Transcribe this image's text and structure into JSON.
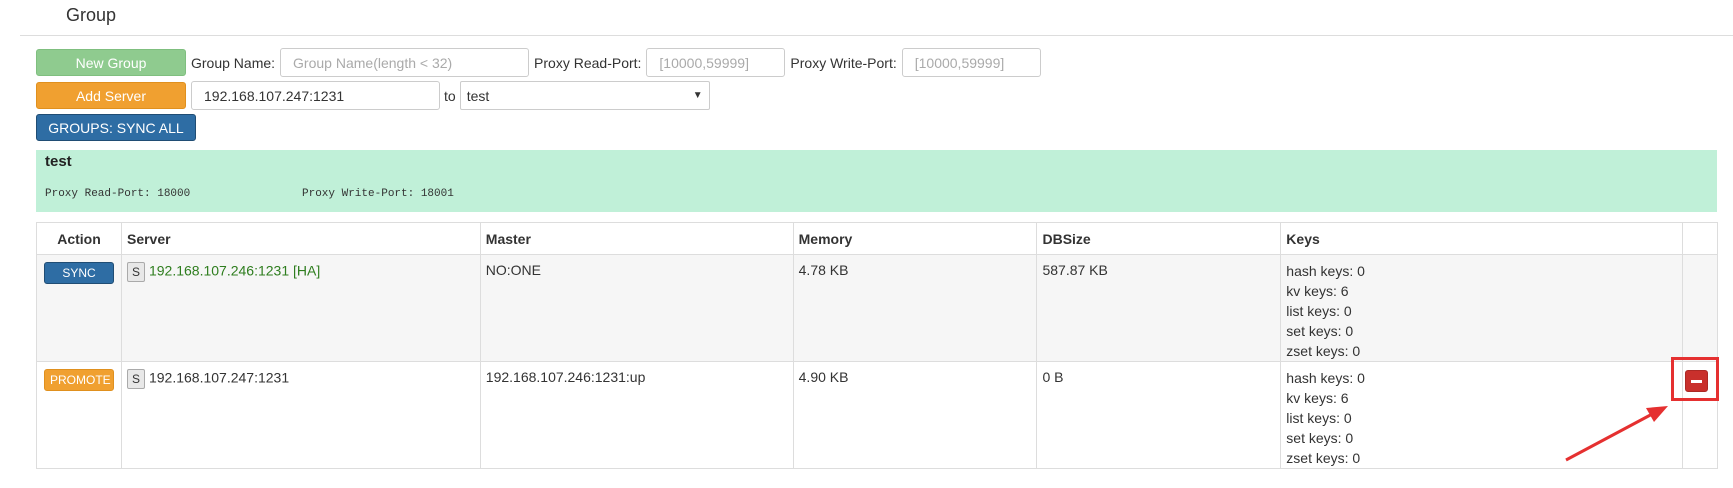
{
  "header": {
    "title": "Group"
  },
  "toolbar": {
    "new_group_label": "New Group",
    "group_name_label": "Group Name:",
    "group_name_placeholder": "Group Name(length < 32)",
    "proxy_read_label": "Proxy Read-Port:",
    "proxy_read_placeholder": "[10000,59999]",
    "proxy_write_label": "Proxy Write-Port:",
    "proxy_write_placeholder": "[10000,59999]",
    "add_server_label": "Add Server",
    "server_value": "192.168.107.247:1231",
    "to_label": "to",
    "target_group": "test",
    "sync_all_label": "GROUPS: SYNC ALL"
  },
  "group": {
    "name": "test",
    "proxy_read": "Proxy Read-Port: 18000",
    "proxy_write": "Proxy Write-Port: 18001"
  },
  "table": {
    "headers": [
      "Action",
      "Server",
      "Master",
      "Memory",
      "DBSize",
      "Keys"
    ],
    "rows": [
      {
        "action": "SYNC",
        "badge": "S",
        "server": "192.168.107.246:1231 [HA]",
        "master": "NO:ONE",
        "memory": "4.78 KB",
        "dbsize": "587.87 KB",
        "keys": [
          "hash keys: 0",
          "kv keys: 6",
          "list keys: 0",
          "set keys: 0",
          "zset keys: 0"
        ]
      },
      {
        "action": "PROMOTE",
        "badge": "S",
        "server": "192.168.107.247:1231",
        "master": "192.168.107.246:1231:up",
        "memory": "4.90 KB",
        "dbsize": "0 B",
        "keys": [
          "hash keys: 0",
          "kv keys: 6",
          "list keys: 0",
          "set keys: 0",
          "zset keys: 0"
        ]
      }
    ]
  },
  "colors": {
    "success": "#8fcb8f",
    "warning": "#f0a030",
    "primary": "#2e6da4",
    "danger": "#c9302c",
    "group_panel": "#c0f0d8",
    "annotation": "#e53030"
  },
  "icons": {
    "remove": "minus-icon",
    "select_arrow": "caret-down-icon"
  }
}
